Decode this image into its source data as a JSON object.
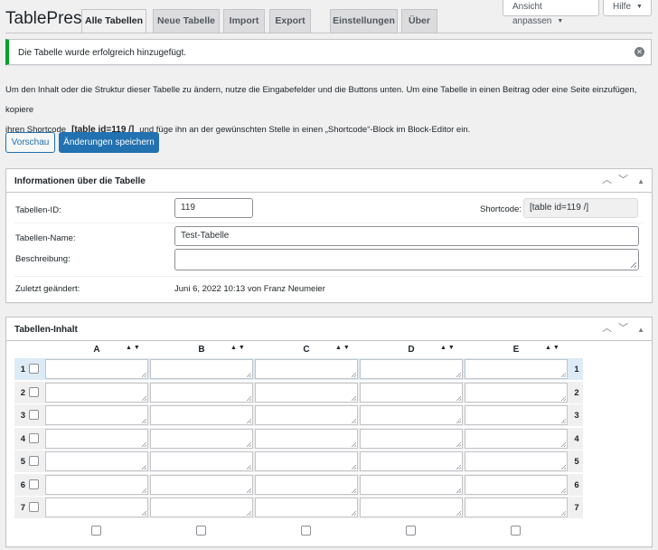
{
  "app": {
    "title": "TablePress"
  },
  "tabs": [
    {
      "label": "Alle Tabellen",
      "active": true
    },
    {
      "label": "Neue Tabelle"
    },
    {
      "label": "Import"
    },
    {
      "label": "Export"
    },
    {
      "label": "Einstellungen"
    },
    {
      "label": "Über"
    }
  ],
  "screen_options": {
    "label": "Ansicht anpassen",
    "help_label": "Hilfe"
  },
  "notice": {
    "message": "Die Tabelle wurde erfolgreich hinzugefügt."
  },
  "intro": {
    "line1": "Um den Inhalt oder die Struktur dieser Tabelle zu ändern, nutze die Eingabefelder und die Buttons unten. Um eine Tabelle in einen Beitrag oder eine Seite einzufügen, kopiere",
    "line2_prefix": "ihren Shortcode",
    "shortcode": "[table id=119 /]",
    "line2_suffix": "und füge ihn an der gewünschten Stelle in einen „Shortcode“-Block im Block-Editor ein."
  },
  "buttons": {
    "preview": "Vorschau",
    "save": "Änderungen speichern"
  },
  "info_box": {
    "title": "Informationen über die Tabelle",
    "id_label": "Tabellen-ID:",
    "id_value": "119",
    "shortcode_label": "Shortcode:",
    "shortcode_value": "[table id=119 /]",
    "name_label": "Tabellen-Name:",
    "name_value": "Test-Tabelle",
    "desc_label": "Beschreibung:",
    "desc_value": "",
    "modified_label": "Zuletzt geändert:",
    "modified_value": "Juni 6, 2022 10:13 von Franz Neumeier"
  },
  "content_box": {
    "title": "Tabellen-Inhalt",
    "columns": [
      "A",
      "B",
      "C",
      "D",
      "E"
    ],
    "rows": [
      "1",
      "2",
      "3",
      "4",
      "5",
      "6",
      "7"
    ],
    "highlighted_row": 1
  },
  "colors": {
    "accent": "#2271b1",
    "success": "#00a32a"
  }
}
